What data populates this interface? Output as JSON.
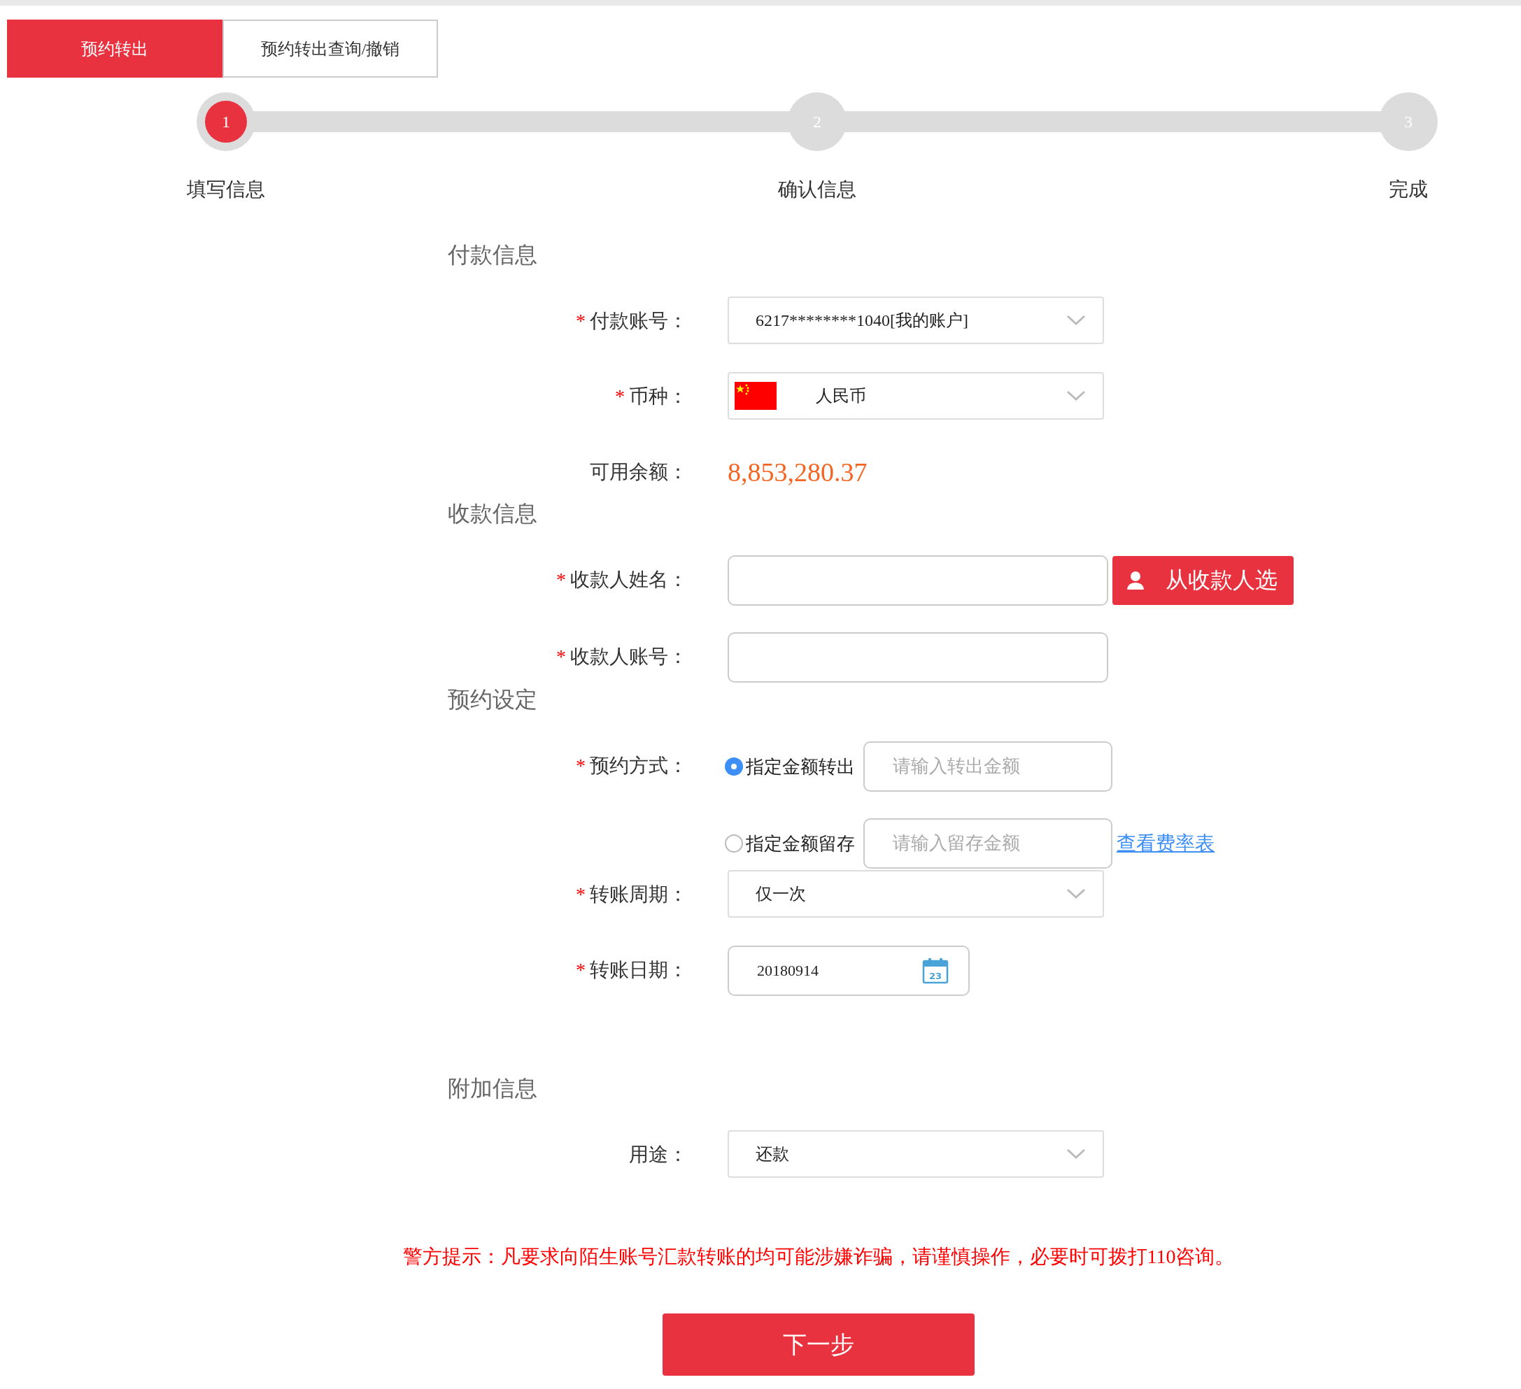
{
  "tabs": [
    {
      "label": "预约转出",
      "selected": true
    },
    {
      "label": "预约转出查询/撤销",
      "selected": false
    }
  ],
  "steps": [
    {
      "number": "1",
      "label": "填写信息",
      "selected": true
    },
    {
      "number": "2",
      "label": "确认信息",
      "selected": false
    },
    {
      "number": "3",
      "label": "完成",
      "selected": false
    }
  ],
  "sections": [
    {
      "title": "付款信息",
      "rows": [
        {
          "kind": "select",
          "mark": "*",
          "label": "付款账号：",
          "value": "6217********1040[我的账户]"
        },
        {
          "kind": "currency",
          "mark": "*",
          "label": "币种：",
          "value": "人民币"
        },
        {
          "kind": "balance",
          "label": "可用余额：",
          "value": "8,853,280.37"
        }
      ]
    },
    {
      "title": "收款信息",
      "rows": [
        {
          "kind": "input",
          "mark": "*",
          "label": "收款人姓名：",
          "button": "从收款人选"
        },
        {
          "kind": "input",
          "mark": "*",
          "label": "收款人账号："
        }
      ]
    },
    {
      "title": "预约设定",
      "rows": [
        {
          "kind": "radio",
          "mark": "*",
          "label": "预约方式：",
          "options": [
            {
              "label": "指定金额转出",
              "selected": true,
              "placeholder": "请输入转出金额"
            },
            {
              "label": "指定金额留存",
              "selected": false,
              "placeholder": "请输入留存金额",
              "link": "查看费率表"
            }
          ]
        },
        {
          "kind": "select",
          "mark": "*",
          "label": "转账周期：",
          "value": "仅一次"
        },
        {
          "kind": "date",
          "mark": "*",
          "label": "转账日期：",
          "value": "20180914",
          "calendar_day": "23"
        }
      ]
    },
    {
      "title": "附加信息",
      "rows": [
        {
          "kind": "select",
          "label": "用途：",
          "value": "还款"
        }
      ]
    }
  ],
  "warning": "警方提示：凡要求向陌生账号汇款转账的均可能涉嫌诈骗，请谨慎操作，必要时可拨打110咨询。",
  "next_button": "下一步"
}
